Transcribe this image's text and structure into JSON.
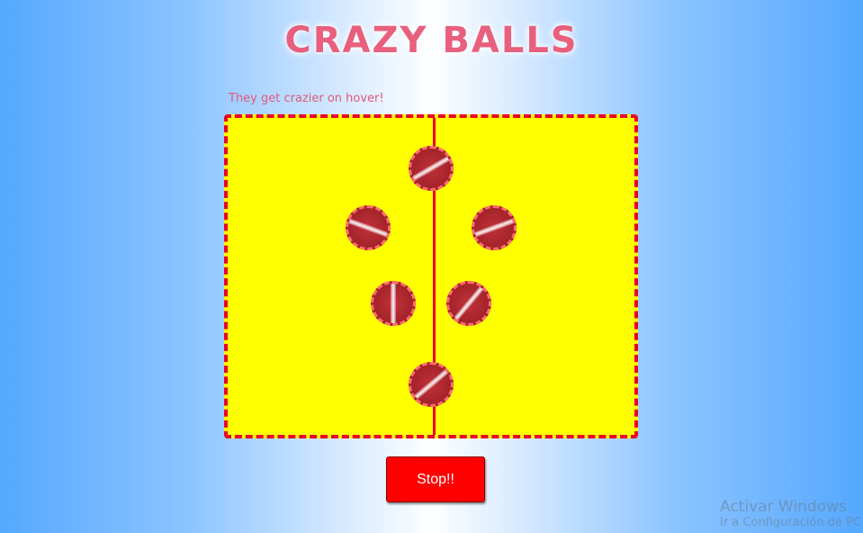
{
  "title": "CRAZY BALLS",
  "hint": "They get crazier on hover!",
  "game": {
    "balls": [
      {
        "id": "ball-top",
        "stripe_angle": -30
      },
      {
        "id": "ball-upper-left",
        "stripe_angle": 20
      },
      {
        "id": "ball-upper-right",
        "stripe_angle": -20
      },
      {
        "id": "ball-middle-left",
        "stripe_angle": 90
      },
      {
        "id": "ball-middle-right",
        "stripe_angle": -50
      },
      {
        "id": "ball-bottom",
        "stripe_angle": -40
      }
    ]
  },
  "controls": {
    "stop_label": "Stop!!"
  },
  "watermark": {
    "line1": "Activar Windows",
    "line2": "Ir a Configuración de PC"
  },
  "colors": {
    "arena": "#ffff00",
    "border": "#e8002a",
    "ball": "#a8252c",
    "button": "#ff0000",
    "title": "#e8607e"
  }
}
